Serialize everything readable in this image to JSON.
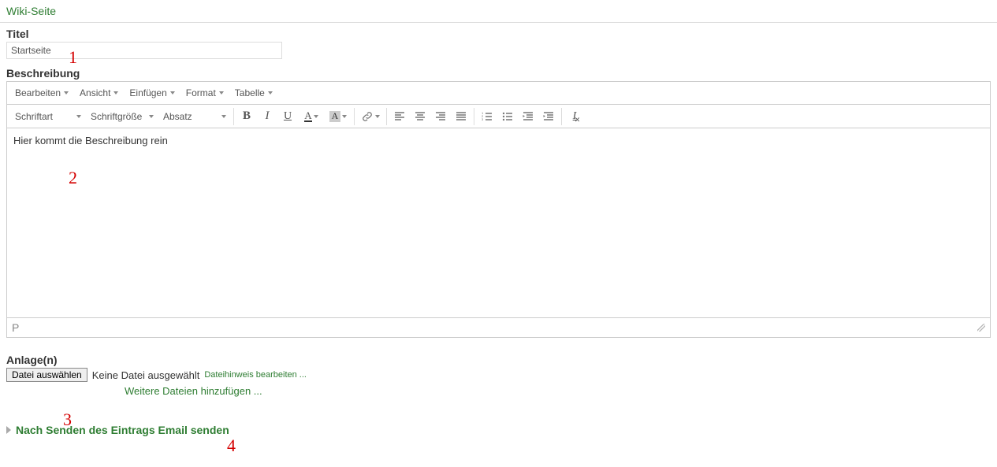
{
  "section_header": "Wiki-Seite",
  "title": {
    "label": "Titel",
    "value": "Startseite"
  },
  "description": {
    "label": "Beschreibung",
    "content": "Hier kommt die Beschreibung rein",
    "status_path": "P"
  },
  "menubar": {
    "edit": "Bearbeiten",
    "view": "Ansicht",
    "insert": "Einfügen",
    "format": "Format",
    "table": "Tabelle"
  },
  "toolbar": {
    "font_family": "Schriftart",
    "font_size": "Schriftgröße",
    "paragraph": "Absatz"
  },
  "attachments": {
    "label": "Anlage(n)",
    "choose_btn": "Datei auswählen",
    "no_file": "Keine Datei ausgewählt",
    "edit_hint": "Dateihinweis bearbeiten ...",
    "more_files": "Weitere Dateien hinzufügen ..."
  },
  "email_expander": "Nach Senden des Eintrags Email senden",
  "annotations": {
    "a1": "1",
    "a2": "2",
    "a3": "3",
    "a4": "4"
  }
}
